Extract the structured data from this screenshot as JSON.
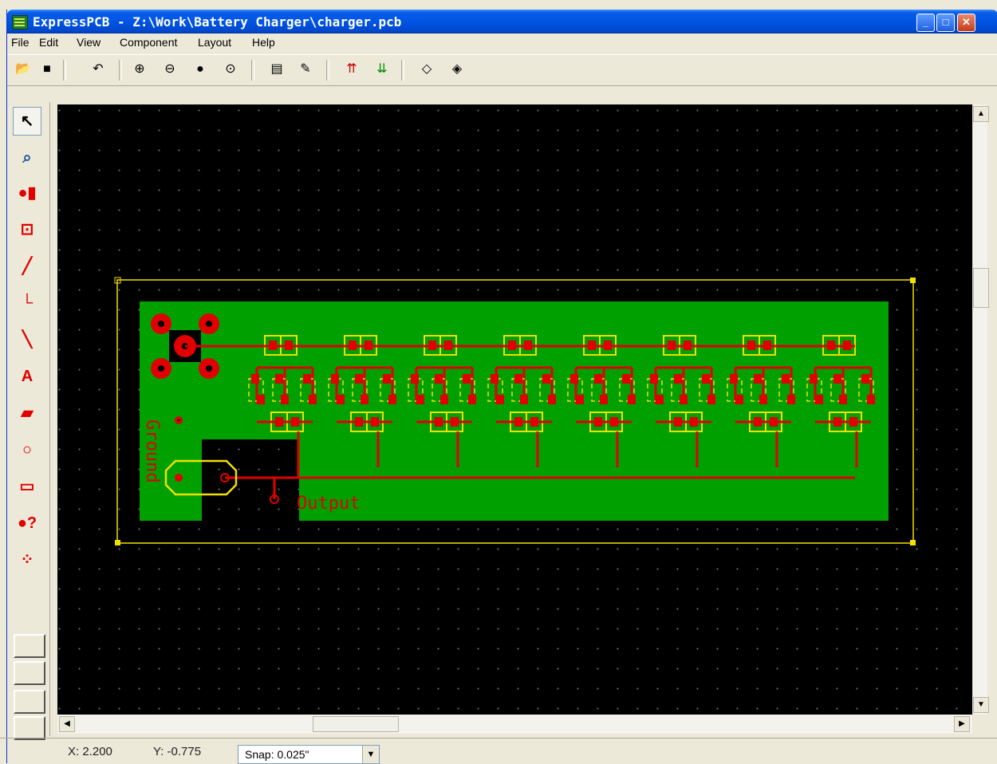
{
  "window": {
    "title": "ExpressPCB - Z:\\Work\\Battery Charger\\charger.pcb",
    "minimize": "_",
    "maximize": "□",
    "close": "✕"
  },
  "menu": [
    "File",
    "Edit",
    "View",
    "Component",
    "Layout",
    "Help"
  ],
  "toolbar": {
    "icons": [
      "open-icon",
      "save-icon",
      "undo-icon",
      "zoom-in-icon",
      "zoom-out-icon",
      "zoom-fit-icon",
      "zoom-previous-icon",
      "properties-icon",
      "component-manager-icon",
      "top-layer-icon",
      "bottom-layer-icon",
      "center-icon",
      "center-on-part-icon"
    ]
  },
  "toolbox": {
    "tools": [
      "pointer-tool",
      "zoom-select-tool",
      "place-pad-tool",
      "place-component-tool",
      "trace-tool",
      "right-angle-trace-tool",
      "diagonal-trace-tool",
      "text-tool",
      "fill-tool",
      "circle-tool",
      "rectangle-tool",
      "query-pad-tool",
      "netlist-tool"
    ]
  },
  "pcb": {
    "label_ground": "Ground",
    "label_output": "Output",
    "colors": {
      "board": "#00A000",
      "copper": "#E00000",
      "silk": "#F0E000",
      "background": "#000000"
    }
  },
  "status": {
    "x": "X: 2.200",
    "y": "Y: -0.775",
    "snap": "Snap: 0.025\""
  }
}
